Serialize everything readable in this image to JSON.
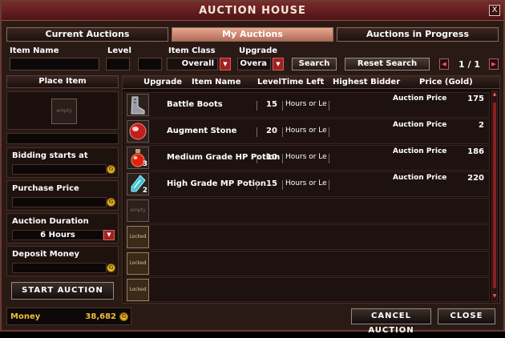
{
  "window": {
    "title": "Auction House",
    "close": "X"
  },
  "tabs": [
    {
      "label": "Current Auctions"
    },
    {
      "label": "My Auctions"
    },
    {
      "label": "Auctions in Progress"
    }
  ],
  "filters": {
    "item_name_label": "Item Name",
    "level_label": "Level",
    "item_class_label": "Item Class",
    "item_class_value": "Overall",
    "upgrade_label": "Upgrade",
    "upgrade_value": "Overa",
    "search_label": "Search",
    "reset_label": "Reset Search",
    "page": "1 / 1"
  },
  "place_item": {
    "header": "Place Item",
    "slot_text": "empty",
    "bidding_label": "Bidding starts at",
    "purchase_label": "Purchase Price",
    "duration_label": "Auction Duration",
    "duration_value": "6 Hours",
    "deposit_label": "Deposit Money",
    "start_label": "Start Auction"
  },
  "list": {
    "columns": [
      "Upgrade",
      "Item Name",
      "Level",
      "Time Left",
      "Highest Bidder",
      "Price (Gold)"
    ],
    "rows": [
      {
        "name": "Battle Boots",
        "qty": "",
        "level": "15",
        "time": "Hours or Les",
        "bidder": "",
        "price_label": "Auction Price",
        "price": "175"
      },
      {
        "name": "Augment Stone",
        "qty": "",
        "level": "20",
        "time": "Hours or Les",
        "bidder": "",
        "price_label": "Auction Price",
        "price": "2"
      },
      {
        "name": "Medium Grade HP Potion",
        "qty": "3",
        "level": "10",
        "time": "Hours or Les",
        "bidder": "",
        "price_label": "Auction Price",
        "price": "186"
      },
      {
        "name": "High Grade MP Potion",
        "qty": "2",
        "level": "15",
        "time": "Hours or Les",
        "bidder": "",
        "price_label": "Auction Price",
        "price": "220"
      }
    ],
    "empty_text": "empty",
    "locked_text": "Locked"
  },
  "footer": {
    "money_label": "Money",
    "money_value": "38,682",
    "cancel_label": "Cancel Auction",
    "close_label": "Close"
  },
  "icons": [
    "boots-icon",
    "augment-stone-icon",
    "hp-potion-icon",
    "mp-potion-icon",
    "gold-coin-icon",
    "dropdown-arrow-icon",
    "page-prev-icon",
    "page-next-icon"
  ]
}
